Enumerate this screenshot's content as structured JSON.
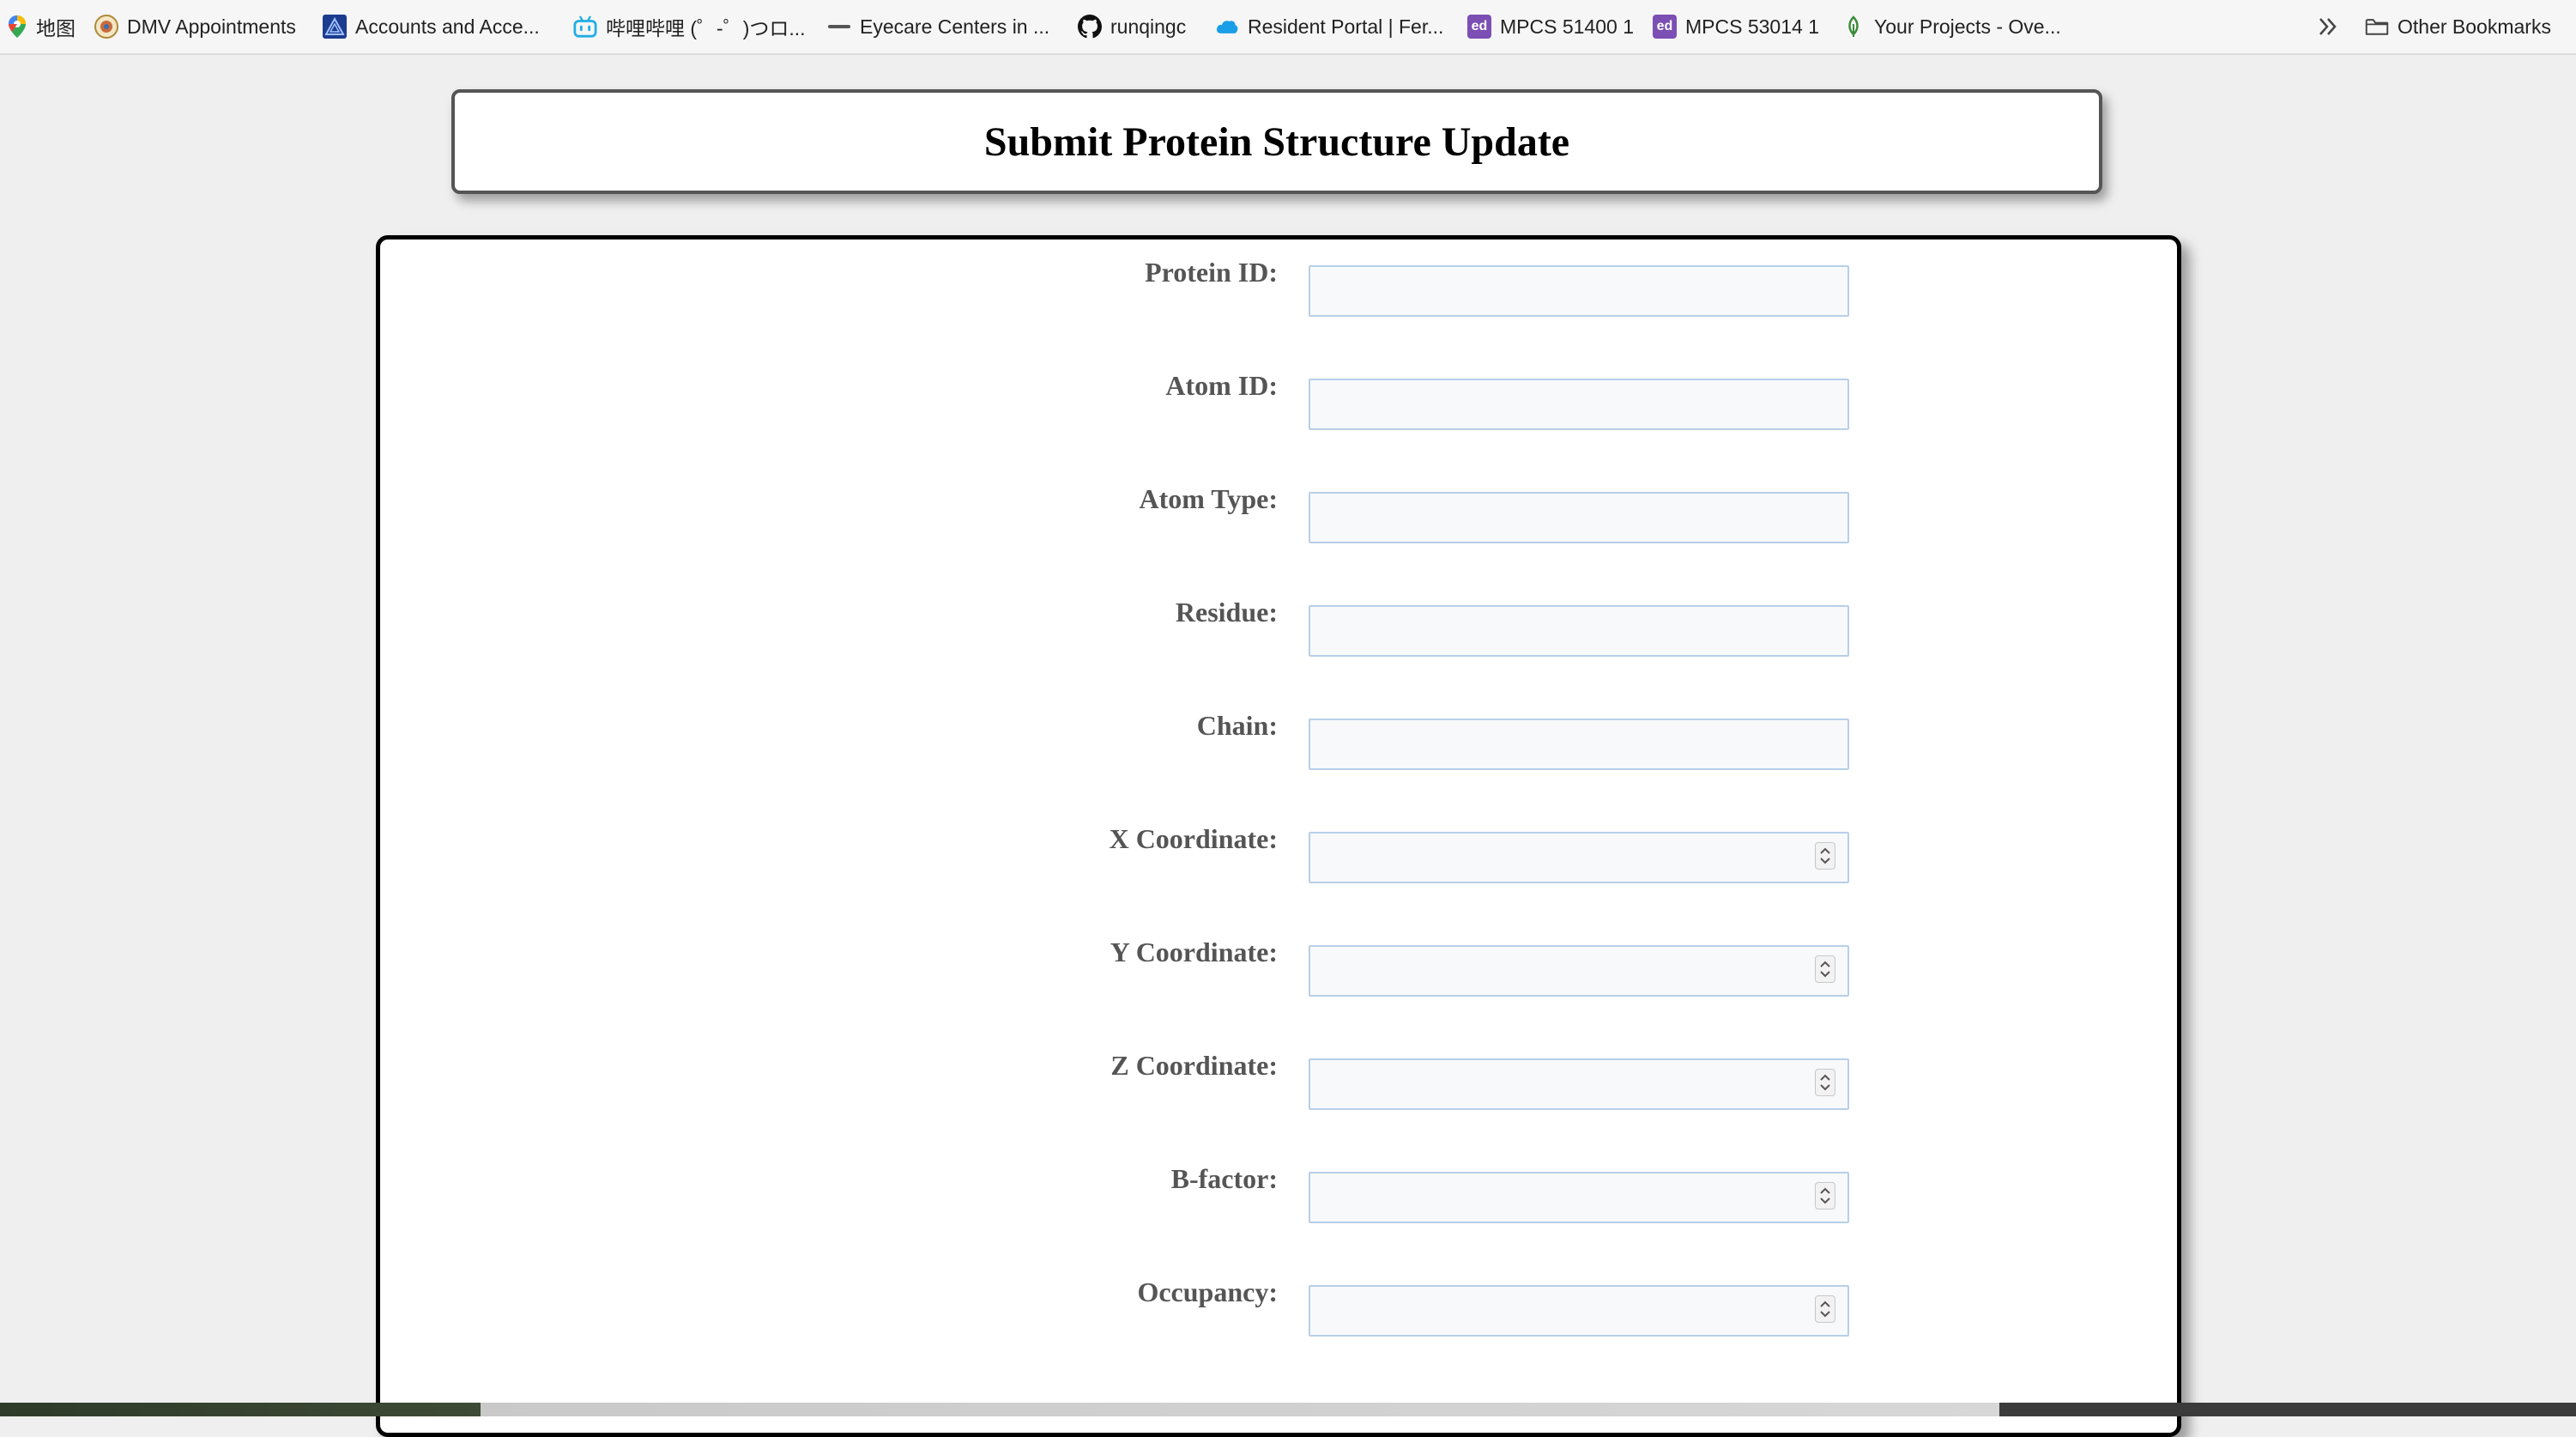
{
  "bookmarks": {
    "items": [
      {
        "label": "地图",
        "icon": "maps-pin-icon"
      },
      {
        "label": "DMV Appointments",
        "icon": "state-seal-icon"
      },
      {
        "label": "Accounts and Acce...",
        "icon": "triangle-logo-icon"
      },
      {
        "label": "哔哩哔哩 (゜-゜)つロ...",
        "icon": "bilibili-tv-icon"
      },
      {
        "label": "Eyecare Centers in ...",
        "icon": "eyecare-logo-icon"
      },
      {
        "label": "runqingc",
        "icon": "github-icon"
      },
      {
        "label": "Resident Portal | Fer...",
        "icon": "cloud-icon"
      },
      {
        "label": "MPCS 51400 1",
        "icon": "ed-icon",
        "icon_text": "ed"
      },
      {
        "label": "MPCS 53014 1",
        "icon": "ed-icon",
        "icon_text": "ed"
      },
      {
        "label": "Your Projects - Ove...",
        "icon": "leaf-icon"
      }
    ],
    "other_label": "Other Bookmarks"
  },
  "page": {
    "title": "Submit Protein Structure Update"
  },
  "form": {
    "fields": [
      {
        "label": "Protein ID:",
        "type": "text",
        "value": ""
      },
      {
        "label": "Atom ID:",
        "type": "text",
        "value": ""
      },
      {
        "label": "Atom Type:",
        "type": "text",
        "value": ""
      },
      {
        "label": "Residue:",
        "type": "text",
        "value": ""
      },
      {
        "label": "Chain:",
        "type": "text",
        "value": ""
      },
      {
        "label": "X Coordinate:",
        "type": "number",
        "value": ""
      },
      {
        "label": "Y Coordinate:",
        "type": "number",
        "value": ""
      },
      {
        "label": "Z Coordinate:",
        "type": "number",
        "value": ""
      },
      {
        "label": "B-factor:",
        "type": "number",
        "value": ""
      },
      {
        "label": "Occupancy:",
        "type": "number",
        "value": ""
      }
    ]
  },
  "colors": {
    "page_background": "#efefef",
    "card_border": "#000000",
    "label_text": "#555555",
    "input_border": "#b8cfe8"
  }
}
